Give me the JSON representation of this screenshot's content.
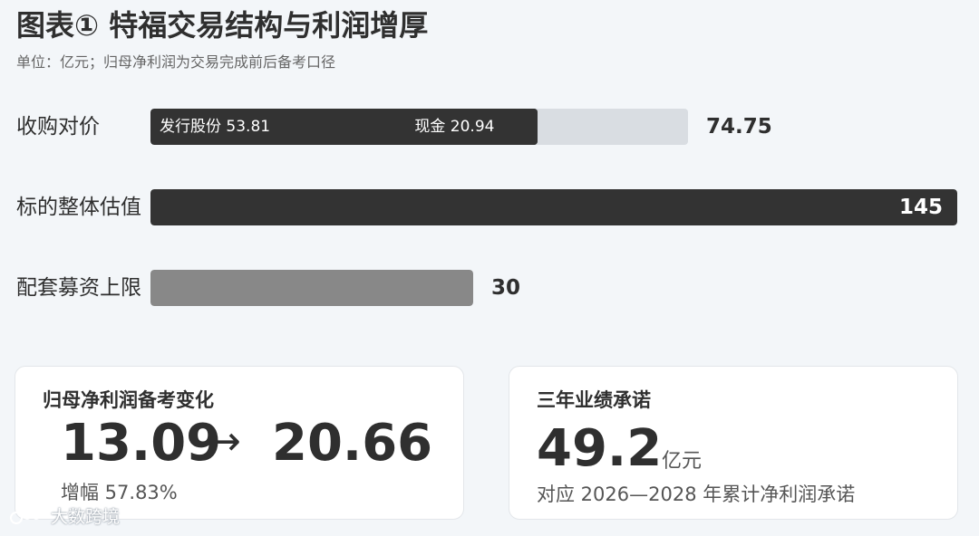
{
  "title": "图表① 特福交易结构与利润增厚",
  "subtitle": "单位：亿元；归母净利润为交易完成前后备考口径",
  "chart_data": {
    "type": "bar",
    "categories": [
      "收购对价",
      "标的整体估值",
      "配套募资上限"
    ],
    "values": [
      74.75,
      145,
      30
    ],
    "value_labels": [
      "74.75",
      "145",
      "30"
    ],
    "stack_for_first": [
      {
        "name": "发行股份",
        "value": 53.81,
        "label": "发行股份 53.81"
      },
      {
        "name": "现金",
        "value": 20.94,
        "label": "现金 20.94"
      }
    ],
    "xlim": [
      0,
      145
    ],
    "colors": {
      "dark": "#333333",
      "grey": "#888888",
      "track": "#d9dde2"
    }
  },
  "cards": {
    "profit": {
      "title": "归母净利润备考变化",
      "from": "13.09",
      "arrow": "→",
      "to": "20.66",
      "note": "增幅 57.83%"
    },
    "commitment": {
      "title": "三年业绩承诺",
      "value": "49.2",
      "unit": "亿元",
      "note": "对应 2026—2028 年累计净利润承诺"
    }
  },
  "watermark": {
    "text": "大数跨境",
    "icon": "logo-icon"
  }
}
